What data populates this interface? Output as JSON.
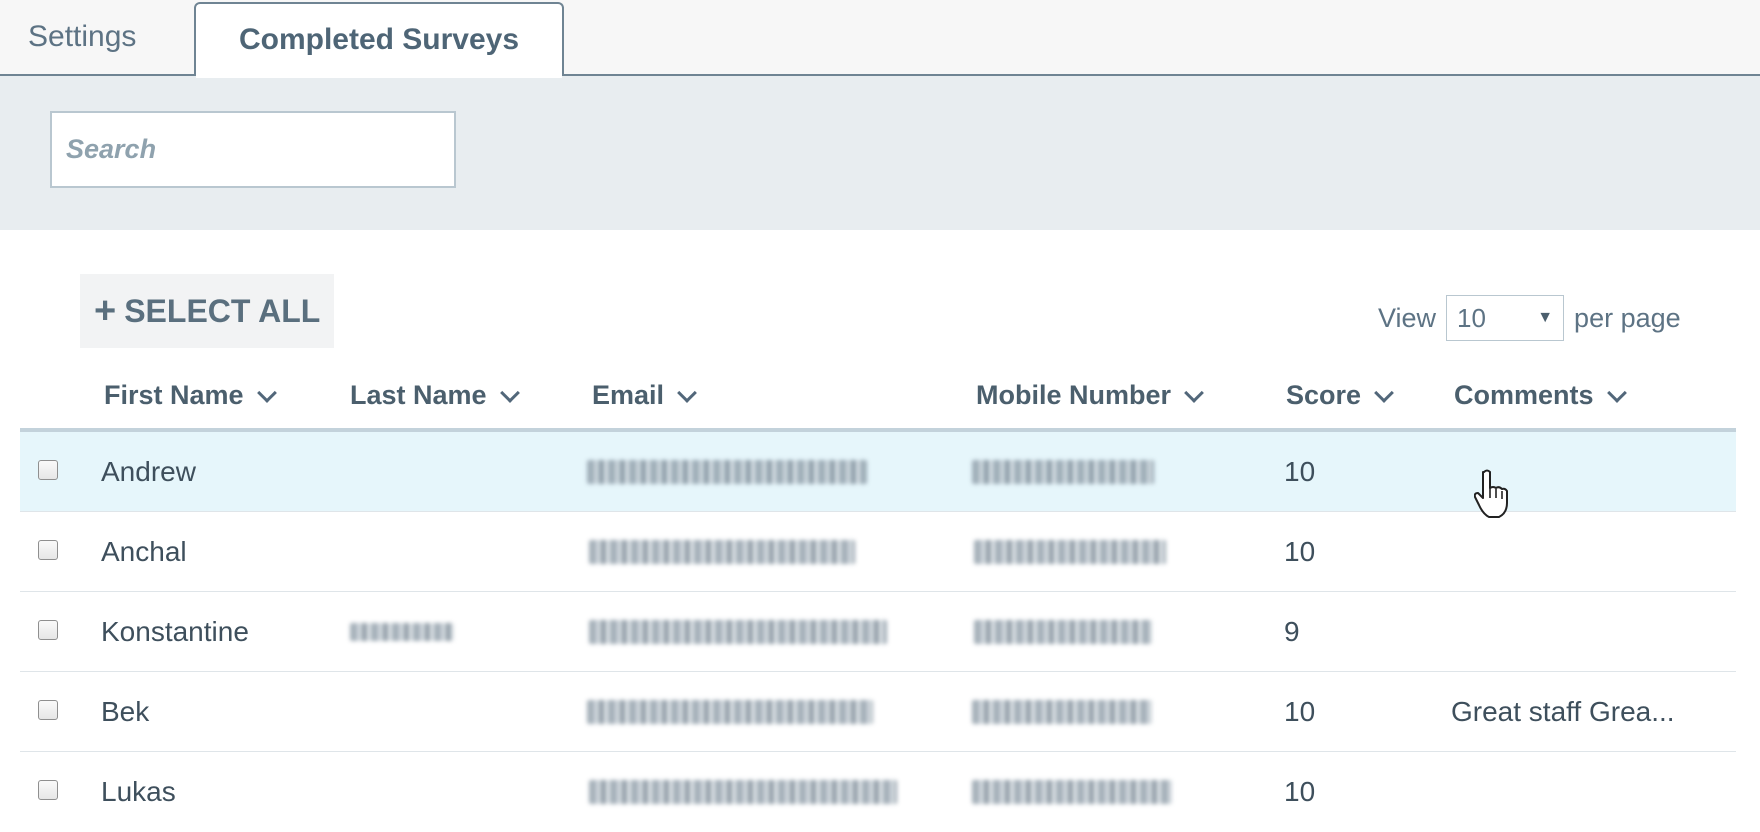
{
  "tabs": [
    {
      "label": "Settings",
      "active": false
    },
    {
      "label": "Completed Surveys",
      "active": true
    }
  ],
  "search": {
    "placeholder": "Search",
    "value": ""
  },
  "toolbar": {
    "select_all_label": "SELECT ALL",
    "select_all_icon": "plus-icon"
  },
  "pagination": {
    "view_label": "View",
    "per_page_value": "10",
    "per_page_label": "per page"
  },
  "table": {
    "columns": [
      "First Name",
      "Last Name",
      "Email",
      "Mobile Number",
      "Score",
      "Comments"
    ],
    "rows": [
      {
        "first_name": "Andrew",
        "score": "10",
        "comments": ""
      },
      {
        "first_name": "Anchal",
        "score": "10",
        "comments": ""
      },
      {
        "first_name": "Konstantine",
        "score": "9",
        "comments": ""
      },
      {
        "first_name": "Bek",
        "score": "10",
        "comments": "Great staff Grea..."
      },
      {
        "first_name": "Lukas",
        "score": "10",
        "comments": ""
      }
    ]
  },
  "colors": {
    "accent": "#6f8493",
    "hover_row": "#e6f6fb",
    "search_band": "#e8edf0"
  }
}
